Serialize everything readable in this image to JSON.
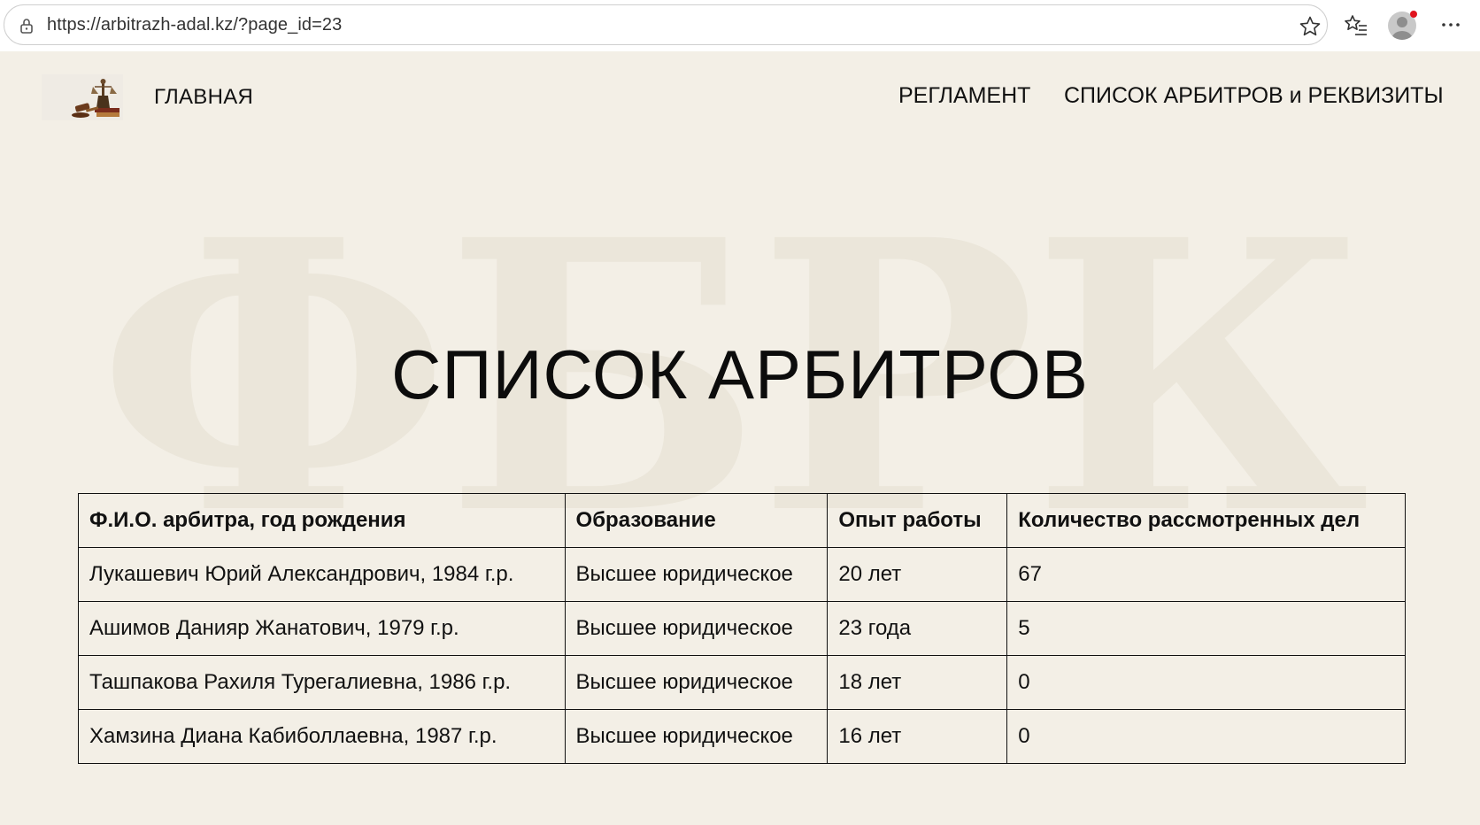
{
  "browser": {
    "url": "https://arbitrazh-adal.kz/?page_id=23"
  },
  "watermark": {
    "text": "ФБРК"
  },
  "header": {
    "home_label": "ГЛАВНАЯ",
    "reglament_label": "РЕГЛАМЕНТ",
    "list_label": "СПИСОК АРБИТРОВ и РЕКВИЗИТЫ"
  },
  "main": {
    "title": "СПИСОК АРБИТРОВ",
    "table": {
      "headers": [
        "Ф.И.О. арбитра, год рождения",
        "Образование",
        "Опыт работы",
        "Количество рассмотренных дел"
      ],
      "rows": [
        [
          "Лукашевич Юрий Александрович, 1984 г.р.",
          "Высшее юридическое",
          "20 лет",
          "67"
        ],
        [
          "Ашимов Данияр Жанатович, 1979 г.р.",
          "Высшее юридическое",
          "23 года",
          "5"
        ],
        [
          "Ташпакова Рахиля Турегалиевна, 1986 г.р.",
          "Высшее юридическое",
          "18 лет",
          "0"
        ],
        [
          "Хамзина Диана Кабиболлаевна, 1987 г.р.",
          "Высшее юридическое",
          "16 лет",
          "0"
        ]
      ]
    }
  },
  "colors": {
    "page_background": "#f3efe6",
    "text": "#111111",
    "watermark": "#ebe6da",
    "notification_dot": "#e0141e"
  }
}
